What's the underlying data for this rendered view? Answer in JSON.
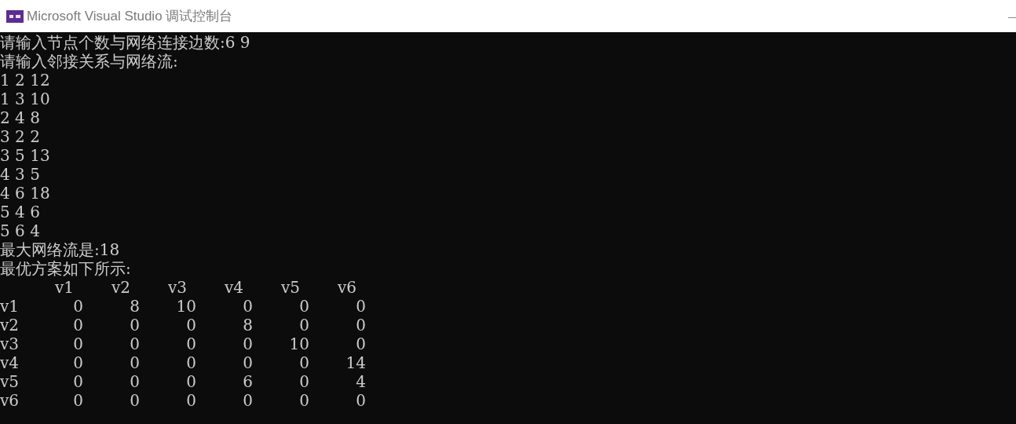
{
  "window": {
    "title": "Microsoft Visual Studio 调试控制台"
  },
  "console": {
    "lines": [
      "请输入节点个数与网络连接边数:6 9",
      "请输入邻接关系与网络流:",
      "1 2 12",
      "1 3 10",
      "2 4 8",
      "3 2 2",
      "3 5 13",
      "4 3 5",
      "4 6 18",
      "5 4 6",
      "5 6 4",
      "最大网络流是:18",
      "最优方案如下所示:"
    ],
    "matrix": {
      "columns": [
        "v1",
        "v2",
        "v3",
        "v4",
        "v5",
        "v6"
      ],
      "rows": [
        {
          "label": "v1",
          "values": [
            "0",
            "8",
            "10",
            "0",
            "0",
            "0"
          ]
        },
        {
          "label": "v2",
          "values": [
            "0",
            "0",
            "0",
            "8",
            "0",
            "0"
          ]
        },
        {
          "label": "v3",
          "values": [
            "0",
            "0",
            "0",
            "0",
            "10",
            "0"
          ]
        },
        {
          "label": "v4",
          "values": [
            "0",
            "0",
            "0",
            "0",
            "0",
            "14"
          ]
        },
        {
          "label": "v5",
          "values": [
            "0",
            "0",
            "0",
            "6",
            "0",
            "4"
          ]
        },
        {
          "label": "v6",
          "values": [
            "0",
            "0",
            "0",
            "0",
            "0",
            "0"
          ]
        }
      ]
    }
  }
}
